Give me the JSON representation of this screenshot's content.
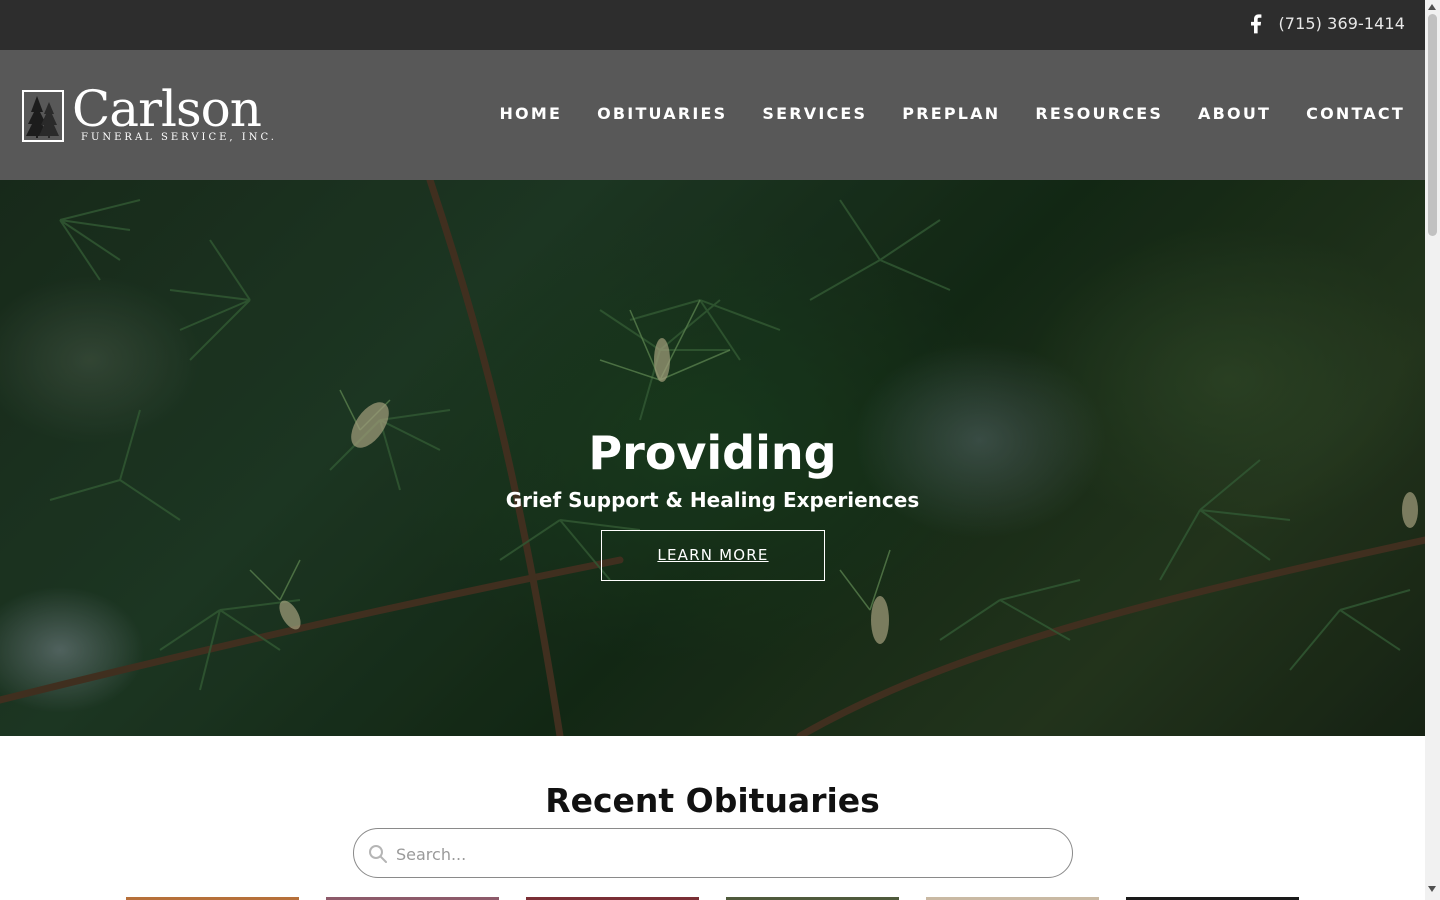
{
  "topbar": {
    "facebook_icon": "facebook-icon",
    "phone": "(715) 369-1414"
  },
  "header": {
    "logo": {
      "name": "Carlson",
      "subtitle": "FUNERAL SERVICE, INC.",
      "mark_icon": "pine-trees-icon"
    },
    "nav": [
      {
        "label": "HOME"
      },
      {
        "label": "OBITUARIES"
      },
      {
        "label": "SERVICES"
      },
      {
        "label": "PREPLAN"
      },
      {
        "label": "RESOURCES"
      },
      {
        "label": "ABOUT"
      },
      {
        "label": "CONTACT"
      }
    ]
  },
  "hero": {
    "title": "Providing",
    "subtitle": "Grief Support & Healing Experiences",
    "cta_label": "LEARN MORE"
  },
  "obituaries": {
    "heading": "Recent Obituaries",
    "search_placeholder": "Search...",
    "search_icon": "search-icon",
    "thumbnail_colors": [
      "#b6703a",
      "#8d5a6a",
      "#7a2f35",
      "#4f5a3c",
      "#c9b9a3",
      "#1a1a1a"
    ]
  },
  "colors": {
    "topbar_bg": "#2d2d2d",
    "header_bg": "#585858",
    "text_light": "#ffffff"
  }
}
